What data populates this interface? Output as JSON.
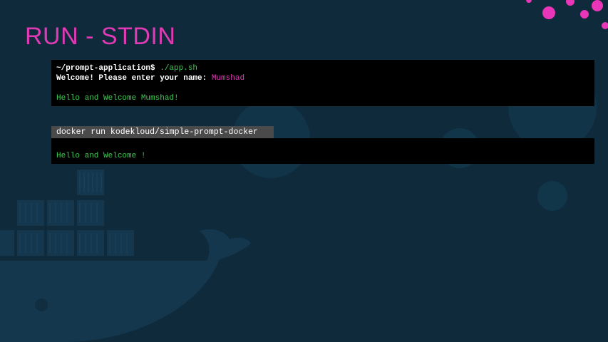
{
  "slide": {
    "title": "RUN - STDIN"
  },
  "terminal1": {
    "prompt": "~/prompt-application$",
    "command": " ./app.sh",
    "question": "Welcome! Please enter your name: ",
    "answer": "Mumshad",
    "greeting": "Hello and Welcome Mumshad!"
  },
  "docker_command": "docker run kodekloud/simple-prompt-docker",
  "terminal2": {
    "greeting": "Hello and Welcome !"
  },
  "colors": {
    "background": "#0f2a3b",
    "accent": "#e03ab5",
    "terminal_green": "#3ecb52",
    "terminal_bg": "#000000",
    "command_bar": "#4a4a4a"
  },
  "decor": {
    "background_logo": "docker-whale-icon",
    "dots": "pink-dots-decoration"
  }
}
